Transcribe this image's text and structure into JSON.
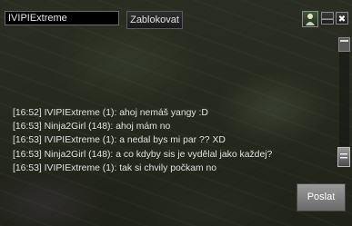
{
  "toolbar": {
    "name_value": "IVIPIExtreme",
    "block_label": "Zablokovat",
    "minimize_glyph": "—",
    "close_glyph": "✖"
  },
  "icons": {
    "profile_icon": "person-icon",
    "minimize_icon": "minimize-icon",
    "close_icon": "close-icon",
    "scroll_up_icon": "scroll-up-icon",
    "scroll_thumb": "scroll-thumb"
  },
  "chat": {
    "lines": [
      {
        "time": "[16:52]",
        "text": "IVIPIExtreme (1): ahoj nemáš yangy :D"
      },
      {
        "time": "[16:53]",
        "text": "Ninja2Girl (148): ahoj mám no"
      },
      {
        "time": "[16:53]",
        "text": "IVIPIExtreme (1): a nedal bys mi par ?? XD"
      },
      {
        "time": "[16:53]",
        "text": "Ninja2Girl (148): a co kdyby sis je vydělal jako každej?"
      },
      {
        "time": "[16:53]",
        "text": "IVIPIExtreme (1): tak si chvily počkam no"
      }
    ]
  },
  "send_label": "Poslat",
  "colors": {
    "chat_text": "#e2e2e2",
    "button_bg": "#8a8a8a",
    "input_bg": "#000000"
  }
}
